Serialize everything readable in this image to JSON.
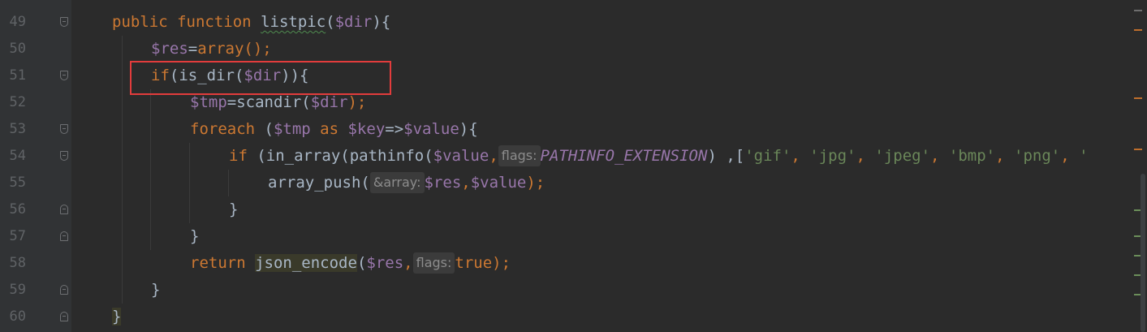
{
  "line_numbers": [
    "49",
    "50",
    "51",
    "52",
    "53",
    "54",
    "55",
    "56",
    "57",
    "58",
    "59",
    "60"
  ],
  "code": {
    "l49": {
      "kw1": "public",
      "kw2": "function",
      "name": "listpic",
      "open": "(",
      "var": "$dir",
      "close": "){"
    },
    "l50": {
      "var": "$res",
      "eq": "=",
      "fn": "array",
      "rest": "();"
    },
    "l51": {
      "kw": "if",
      "p1": "(is_dir(",
      "var": "$dir",
      "p2": ")){"
    },
    "l52": {
      "var1": "$tmp",
      "eq": "=scandir(",
      "var2": "$dir",
      "rest": ");"
    },
    "l53": {
      "kw": "foreach",
      "p1": " (",
      "var1": "$tmp",
      "as": " as ",
      "var2": "$key",
      "arrow": "=>",
      "var3": "$value",
      "p2": "){"
    },
    "l54": {
      "kw": "if",
      "p1": " (in_array(pathinfo(",
      "var": "$value",
      "comma1": ",",
      "hint": "flags:",
      "const": "PATHINFO_EXTENSION",
      "p2": ") ,[",
      "s1": "'gif'",
      "c1": ", ",
      "s2": "'jpg'",
      "c2": ", ",
      "s3": "'jpeg'",
      "c3": ", ",
      "s4": "'bmp'",
      "c4": ", ",
      "s5": "'png'",
      "c5": ", ",
      "s6": "'"
    },
    "l55": {
      "fn": "array_push(",
      "hint": "&array:",
      "var1": "$res",
      "comma": ",",
      "var2": "$value",
      "rest": ");"
    },
    "l56": {
      "brace": "}"
    },
    "l57": {
      "brace": "}"
    },
    "l58": {
      "kw": "return",
      "fn": "json_encode",
      "open": "(",
      "var": "$res",
      "comma": ",",
      "hint": "flags:",
      "val": "true",
      "rest": ");"
    },
    "l59": {
      "brace": "}"
    },
    "l60": {
      "brace": "}"
    }
  },
  "colors": {
    "keyword": "#cc7832",
    "variable": "#9876aa",
    "string": "#6a8759",
    "function": "#ffc66d",
    "text": "#a9b7c6",
    "annotation": "#e23c3c"
  }
}
